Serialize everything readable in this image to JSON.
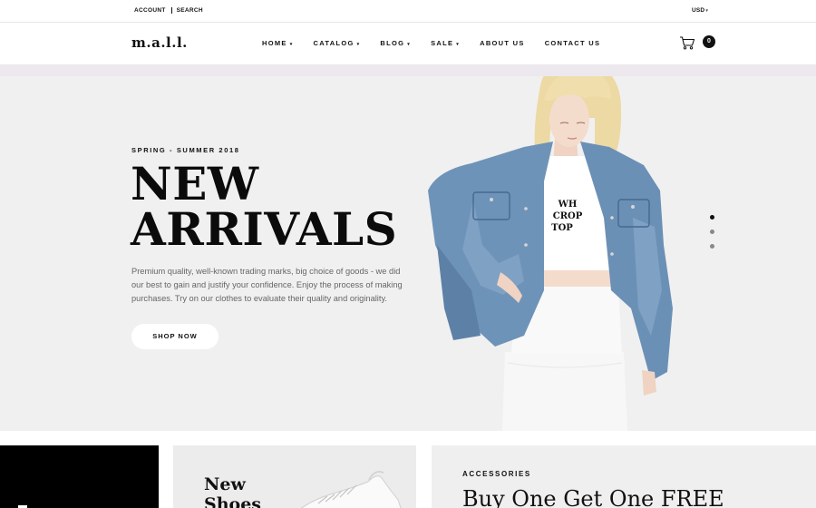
{
  "topbar": {
    "links": [
      "ACCOUNT",
      "SEARCH"
    ],
    "currency": "USD"
  },
  "header": {
    "logo": "m.a.l.l.",
    "nav": [
      {
        "label": "HOME",
        "has_dropdown": true,
        "active": true
      },
      {
        "label": "CATALOG",
        "has_dropdown": true,
        "active": false
      },
      {
        "label": "BLOG",
        "has_dropdown": true,
        "active": false
      },
      {
        "label": "SALE",
        "has_dropdown": true,
        "active": false
      },
      {
        "label": "ABOUT US",
        "has_dropdown": false,
        "active": false
      },
      {
        "label": "CONTACT US",
        "has_dropdown": false,
        "active": false
      }
    ],
    "cart_icon": "shopping-cart-icon",
    "cart_count": "0"
  },
  "hero": {
    "season": "SPRING - SUMMER 2018",
    "headline_line1": "NEW",
    "headline_line2": "ARRIVALS",
    "description": "Premium quality, well-known trading marks, big choice of goods - we did our best to gain and justify your confidence. Enjoy the process of making purchases. Try on our clothes to evaluate their quality and originality.",
    "button": "SHOP NOW",
    "shirt_text": [
      "WH",
      "CROP",
      "TOP"
    ],
    "slides": 3,
    "active_slide": 0
  },
  "banners": {
    "shoes_title_line1": "New",
    "shoes_title_line2": "Shoes",
    "accessories_eyebrow": "ACCESSORIES",
    "accessories_promo": "Buy One Get One FREE"
  },
  "colors": {
    "accent": "#111111",
    "hero_bg": "#f0f0f0",
    "denim": "#6f93b8"
  }
}
